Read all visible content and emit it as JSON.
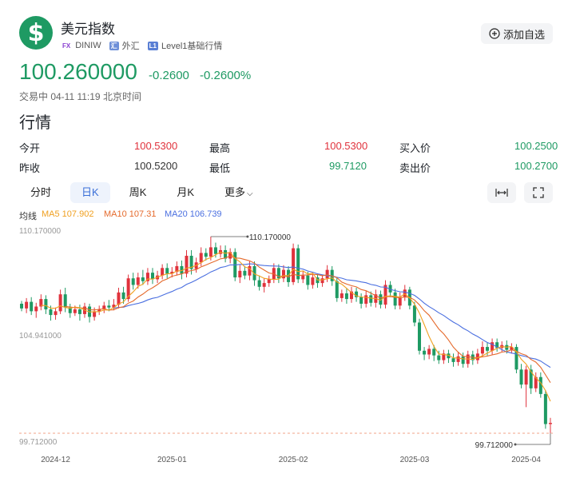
{
  "header": {
    "logo_symbol": "$",
    "name": "美元指数",
    "exchange_tag": "FX",
    "code": "DINIW",
    "category_tag": "外汇",
    "level_tag": "L1",
    "level_text": "Level1基础行情",
    "add_button": "添加自选"
  },
  "quote": {
    "price": "100.260000",
    "change": "-0.2600",
    "change_pct": "-0.2600%",
    "status": "交易中 04-11 11:19 北京时间"
  },
  "section_title": "行情",
  "stats": {
    "open_label": "今开",
    "open": "100.5300",
    "high_label": "最高",
    "high": "100.5300",
    "bid_label": "买入价",
    "bid": "100.2500",
    "prev_close_label": "昨收",
    "prev_close": "100.5200",
    "low_label": "最低",
    "low": "99.7120",
    "ask_label": "卖出价",
    "ask": "100.2700"
  },
  "tabs": [
    "分时",
    "日K",
    "周K",
    "月K",
    "更多"
  ],
  "active_tab": 1,
  "ma_legend": {
    "label": "均线",
    "ma5": "MA5 107.902",
    "ma10": "MA10 107.31",
    "ma20": "MA20 106.739"
  },
  "colors": {
    "up": "#e0323c",
    "down": "#1e9a63",
    "ma5": "#f0a020",
    "ma10": "#e56a2c",
    "ma20": "#4a6fe0"
  },
  "chart_data": {
    "type": "candlestick",
    "y_labels": [
      "110.170000",
      "104.941000",
      "99.712000"
    ],
    "x_labels": [
      "2024-12",
      "2025-01",
      "2025-02",
      "2025-03",
      "2025-04"
    ],
    "ylim": [
      99.712,
      110.17
    ],
    "high_annotation": "110.170000",
    "low_annotation": "99.712000",
    "candles": [
      [
        106.6,
        106.35,
        106.75,
        106.2
      ],
      [
        106.35,
        106.7,
        106.9,
        106.1
      ],
      [
        106.7,
        106.2,
        106.95,
        106.0
      ],
      [
        106.2,
        106.45,
        106.65,
        105.85
      ],
      [
        106.45,
        106.85,
        107.1,
        106.25
      ],
      [
        106.85,
        106.3,
        107.05,
        106.05
      ],
      [
        106.3,
        106.0,
        106.5,
        105.7
      ],
      [
        106.0,
        106.2,
        106.4,
        105.75
      ],
      [
        106.2,
        107.1,
        107.35,
        106.05
      ],
      [
        107.1,
        106.4,
        107.45,
        106.15
      ],
      [
        106.4,
        106.1,
        106.6,
        105.85
      ],
      [
        106.1,
        106.3,
        106.5,
        105.95
      ],
      [
        106.3,
        106.05,
        106.55,
        105.7
      ],
      [
        106.05,
        106.45,
        106.65,
        105.85
      ],
      [
        106.45,
        105.9,
        106.6,
        105.6
      ],
      [
        105.9,
        106.2,
        106.4,
        105.7
      ],
      [
        106.2,
        106.3,
        106.5,
        106.0
      ],
      [
        106.3,
        106.5,
        106.7,
        106.1
      ],
      [
        106.5,
        106.4,
        106.8,
        106.2
      ],
      [
        106.4,
        106.55,
        106.85,
        106.25
      ],
      [
        106.55,
        107.2,
        107.45,
        106.35
      ],
      [
        107.2,
        106.85,
        107.5,
        106.6
      ],
      [
        106.85,
        107.95,
        108.15,
        106.7
      ],
      [
        107.95,
        107.6,
        108.25,
        107.35
      ],
      [
        107.6,
        108.0,
        108.25,
        107.4
      ],
      [
        108.0,
        107.8,
        108.4,
        107.6
      ],
      [
        107.8,
        108.25,
        108.5,
        107.6
      ],
      [
        108.25,
        107.9,
        108.5,
        107.65
      ],
      [
        107.9,
        108.1,
        108.35,
        107.7
      ],
      [
        108.1,
        108.5,
        108.7,
        107.9
      ],
      [
        108.5,
        108.2,
        108.75,
        107.95
      ],
      [
        108.2,
        108.3,
        108.55,
        108.0
      ],
      [
        108.3,
        108.6,
        108.85,
        108.1
      ],
      [
        108.6,
        108.2,
        108.9,
        107.9
      ],
      [
        108.2,
        109.15,
        109.45,
        108.0
      ],
      [
        109.15,
        108.45,
        109.45,
        108.15
      ],
      [
        108.45,
        108.8,
        109.05,
        108.25
      ],
      [
        108.8,
        109.3,
        109.6,
        108.6
      ],
      [
        109.3,
        109.1,
        109.55,
        108.9
      ],
      [
        109.1,
        109.6,
        110.17,
        108.9
      ],
      [
        109.6,
        109.25,
        109.85,
        109.05
      ],
      [
        109.25,
        109.45,
        109.7,
        109.05
      ],
      [
        109.45,
        109.0,
        109.7,
        108.8
      ],
      [
        109.0,
        109.35,
        109.55,
        108.75
      ],
      [
        109.35,
        108.0,
        109.55,
        107.8
      ],
      [
        108.0,
        108.35,
        108.65,
        107.7
      ],
      [
        108.35,
        108.1,
        108.6,
        107.9
      ],
      [
        108.1,
        108.6,
        108.85,
        107.85
      ],
      [
        108.6,
        107.85,
        108.85,
        107.55
      ],
      [
        107.85,
        107.5,
        108.1,
        107.3
      ],
      [
        107.5,
        107.7,
        107.95,
        107.2
      ],
      [
        107.7,
        107.9,
        108.1,
        107.5
      ],
      [
        107.9,
        108.5,
        108.75,
        107.7
      ],
      [
        108.5,
        107.95,
        108.7,
        107.7
      ],
      [
        107.95,
        108.4,
        108.65,
        107.75
      ],
      [
        108.4,
        107.75,
        108.6,
        107.5
      ],
      [
        107.75,
        109.55,
        109.8,
        107.6
      ],
      [
        109.55,
        107.9,
        109.75,
        107.7
      ],
      [
        107.9,
        108.1,
        108.35,
        107.7
      ],
      [
        108.1,
        107.6,
        108.3,
        107.35
      ],
      [
        107.6,
        108.0,
        108.2,
        107.4
      ],
      [
        108.0,
        107.7,
        108.2,
        107.45
      ],
      [
        107.7,
        107.95,
        108.15,
        107.5
      ],
      [
        107.95,
        108.4,
        108.65,
        107.75
      ],
      [
        108.4,
        107.8,
        108.6,
        107.55
      ],
      [
        107.8,
        106.9,
        108.0,
        106.7
      ],
      [
        106.9,
        107.15,
        107.35,
        106.7
      ],
      [
        107.15,
        106.85,
        107.4,
        106.6
      ],
      [
        106.85,
        107.25,
        107.5,
        106.65
      ],
      [
        107.25,
        106.95,
        107.45,
        106.7
      ],
      [
        106.95,
        106.6,
        107.15,
        106.35
      ],
      [
        106.6,
        107.05,
        107.3,
        106.4
      ],
      [
        107.05,
        106.65,
        107.25,
        106.45
      ],
      [
        106.65,
        107.1,
        107.35,
        106.4
      ],
      [
        107.1,
        106.55,
        107.3,
        106.35
      ],
      [
        106.55,
        107.6,
        107.85,
        106.35
      ],
      [
        107.6,
        107.2,
        107.8,
        106.95
      ],
      [
        107.2,
        106.5,
        107.4,
        106.3
      ],
      [
        106.5,
        106.95,
        107.2,
        106.3
      ],
      [
        106.95,
        107.35,
        107.6,
        106.75
      ],
      [
        107.35,
        106.5,
        107.5,
        106.3
      ],
      [
        106.5,
        105.6,
        106.7,
        105.4
      ],
      [
        105.6,
        104.1,
        105.8,
        103.9
      ],
      [
        104.1,
        103.9,
        104.3,
        103.6
      ],
      [
        103.9,
        104.2,
        104.4,
        103.65
      ],
      [
        104.2,
        103.85,
        104.4,
        103.55
      ],
      [
        103.85,
        103.6,
        104.1,
        103.4
      ],
      [
        103.6,
        103.95,
        104.15,
        103.4
      ],
      [
        103.95,
        103.7,
        104.15,
        103.45
      ],
      [
        103.7,
        103.5,
        103.95,
        103.25
      ],
      [
        103.5,
        103.8,
        104.05,
        103.3
      ],
      [
        103.8,
        103.4,
        104.0,
        103.2
      ],
      [
        103.4,
        103.9,
        104.1,
        103.2
      ],
      [
        103.9,
        103.6,
        104.1,
        103.35
      ],
      [
        103.6,
        103.95,
        104.2,
        103.4
      ],
      [
        103.95,
        104.3,
        104.6,
        103.75
      ],
      [
        104.3,
        104.1,
        104.55,
        103.85
      ],
      [
        104.1,
        104.55,
        104.75,
        103.9
      ],
      [
        104.55,
        104.25,
        104.75,
        104.05
      ],
      [
        104.25,
        104.4,
        104.6,
        104.05
      ],
      [
        104.4,
        104.15,
        104.65,
        103.95
      ],
      [
        104.15,
        104.3,
        104.5,
        103.95
      ],
      [
        104.3,
        103.1,
        104.45,
        102.9
      ],
      [
        103.1,
        102.3,
        103.4,
        102.1
      ],
      [
        102.3,
        103.1,
        103.3,
        101.1
      ],
      [
        103.1,
        102.1,
        103.35,
        101.8
      ],
      [
        102.1,
        102.7,
        102.95,
        101.9
      ],
      [
        102.7,
        101.8,
        102.95,
        101.6
      ],
      [
        101.8,
        100.2,
        102.0,
        99.95
      ],
      [
        100.2,
        100.26,
        100.53,
        99.712
      ]
    ]
  }
}
